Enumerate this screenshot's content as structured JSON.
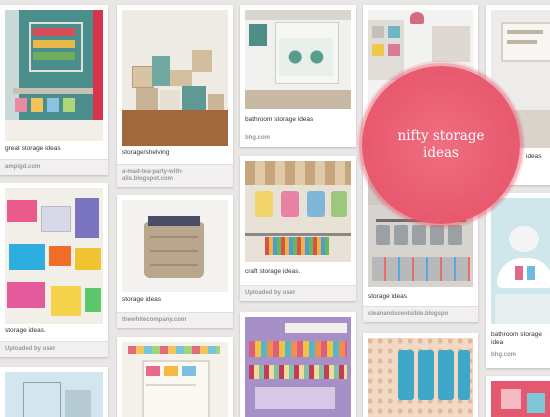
{
  "badge": {
    "line1": "nifty storage",
    "line2": "ideas"
  },
  "pins": [
    {
      "caption": "great storage ideas",
      "source": "ampigd.com"
    },
    {
      "caption": "storage/shelving",
      "source": "a-mad-tea-party-with-alis.blogspot.com"
    },
    {
      "caption": "bathroom storage ideas",
      "source": "bhg.com"
    },
    {
      "caption": "",
      "source": ""
    },
    {
      "caption": "ideas",
      "source": ""
    },
    {
      "caption": "storage ideas.",
      "source": "Uploaded by user"
    },
    {
      "caption": "storage ideas",
      "source": "thewhitecompany.com"
    },
    {
      "caption": "craft storage ideas.",
      "source": "Uploaded by user"
    },
    {
      "caption": "storage ideas",
      "source": "cleanandscentsible.blogspo"
    },
    {
      "caption": "bathroom storage idea",
      "source": "bhg.com"
    }
  ]
}
